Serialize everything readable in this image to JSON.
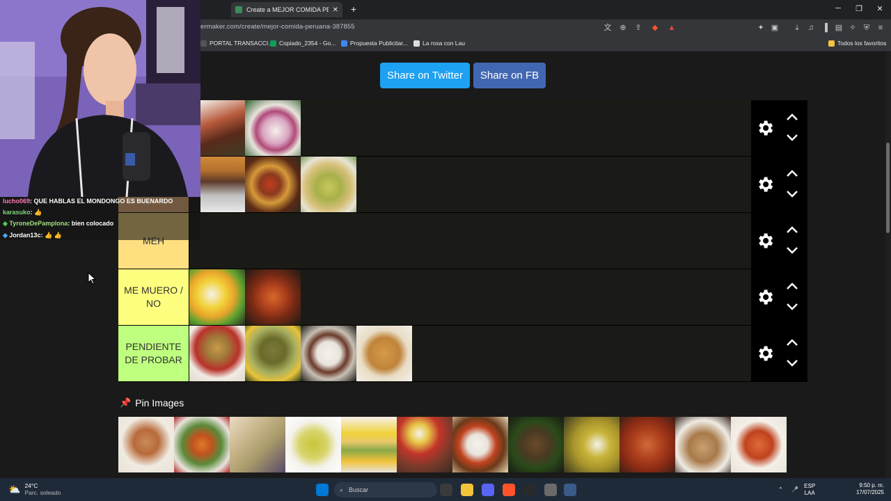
{
  "browser": {
    "tab_title": "Create a MEJOR COMIDA PERUA",
    "new_tab": "+",
    "url": "ermaker.com/create/mejor-comida-peruana-387855",
    "bookmarks": [
      "PORTAL TRANSACCI...",
      "Copiado_2354 - Go...",
      "Propuesta Publicitar...",
      "La rosa con Lau"
    ],
    "all_bookmarks": "Todos los favoritos"
  },
  "share": {
    "twitter": "Share on Twitter",
    "facebook": "Share on FB"
  },
  "tiers": [
    {
      "label": "",
      "color": "#ff7f7f",
      "items": 2
    },
    {
      "label": "",
      "color": "#ffbf7f",
      "items": 3
    },
    {
      "label": "MEH",
      "color": "#ffdf7f",
      "items": 0
    },
    {
      "label": "ME MUERO / NO",
      "color": "#ffff7f",
      "items": 2
    },
    {
      "label": "PENDIENTE DE PROBAR",
      "color": "#bfff7f",
      "items": 4
    }
  ],
  "chat": [
    {
      "user": "lucho069",
      "text": ": QUE HABLAS EL MONDONGO ES BUENARDO",
      "color": "#ff7ab4"
    },
    {
      "user": "karasuko",
      "text": ": 👍",
      "color": "#7dd87d"
    },
    {
      "user": "TyroneDePamplona",
      "text": ": bien colocado",
      "color": "#9fe07f"
    },
    {
      "user": "Jordan13c",
      "text": ": 👍 👍",
      "color": "#ffffff"
    }
  ],
  "pin_images": "Pin Images",
  "taskbar": {
    "temp": "24°C",
    "weather": "Parc. soleado",
    "search": "Buscar",
    "lang1": "ESP",
    "lang2": "LAA",
    "time": "9:50 p. m.",
    "date": "17/07/2025"
  }
}
